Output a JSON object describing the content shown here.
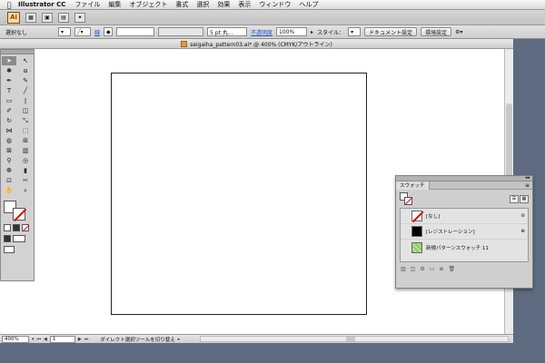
{
  "menubar": {
    "app_name": "Illustrator CC",
    "items": [
      "ファイル",
      "編集",
      "オブジェクト",
      "書式",
      "選択",
      "効果",
      "表示",
      "ウィンドウ",
      "ヘルプ"
    ]
  },
  "appbar": {
    "logo": "Ai"
  },
  "controlbar": {
    "selection_label": "選択なし",
    "stroke_label": "線",
    "brush_size": "5 pt 丸...",
    "opacity_label": "不透明度",
    "opacity_value": "100%",
    "style_label": "スタイル：",
    "doc_settings_button": "ドキュメント設定",
    "preferences_button": "環境設定"
  },
  "document": {
    "title": "seigaiha_pattern03.ai* @ 400% (CMYK/アウトライン)"
  },
  "statusbar": {
    "zoom": "400%",
    "artboard_number": "1",
    "status_text": "ダイレクト選択ツールを切り替え"
  },
  "swatches": {
    "tab_label": "スウォッチ",
    "items": [
      {
        "label": "[なし]",
        "kind": "none",
        "flag": "⊘"
      },
      {
        "label": "[レジストレーション]",
        "kind": "registration",
        "flag": "⊕"
      },
      {
        "label": "新規パターンスウォッチ 11",
        "kind": "pattern",
        "flag": ""
      }
    ]
  },
  "colors": {
    "desktop": "#5d6a80",
    "none_red": "#d00000"
  }
}
